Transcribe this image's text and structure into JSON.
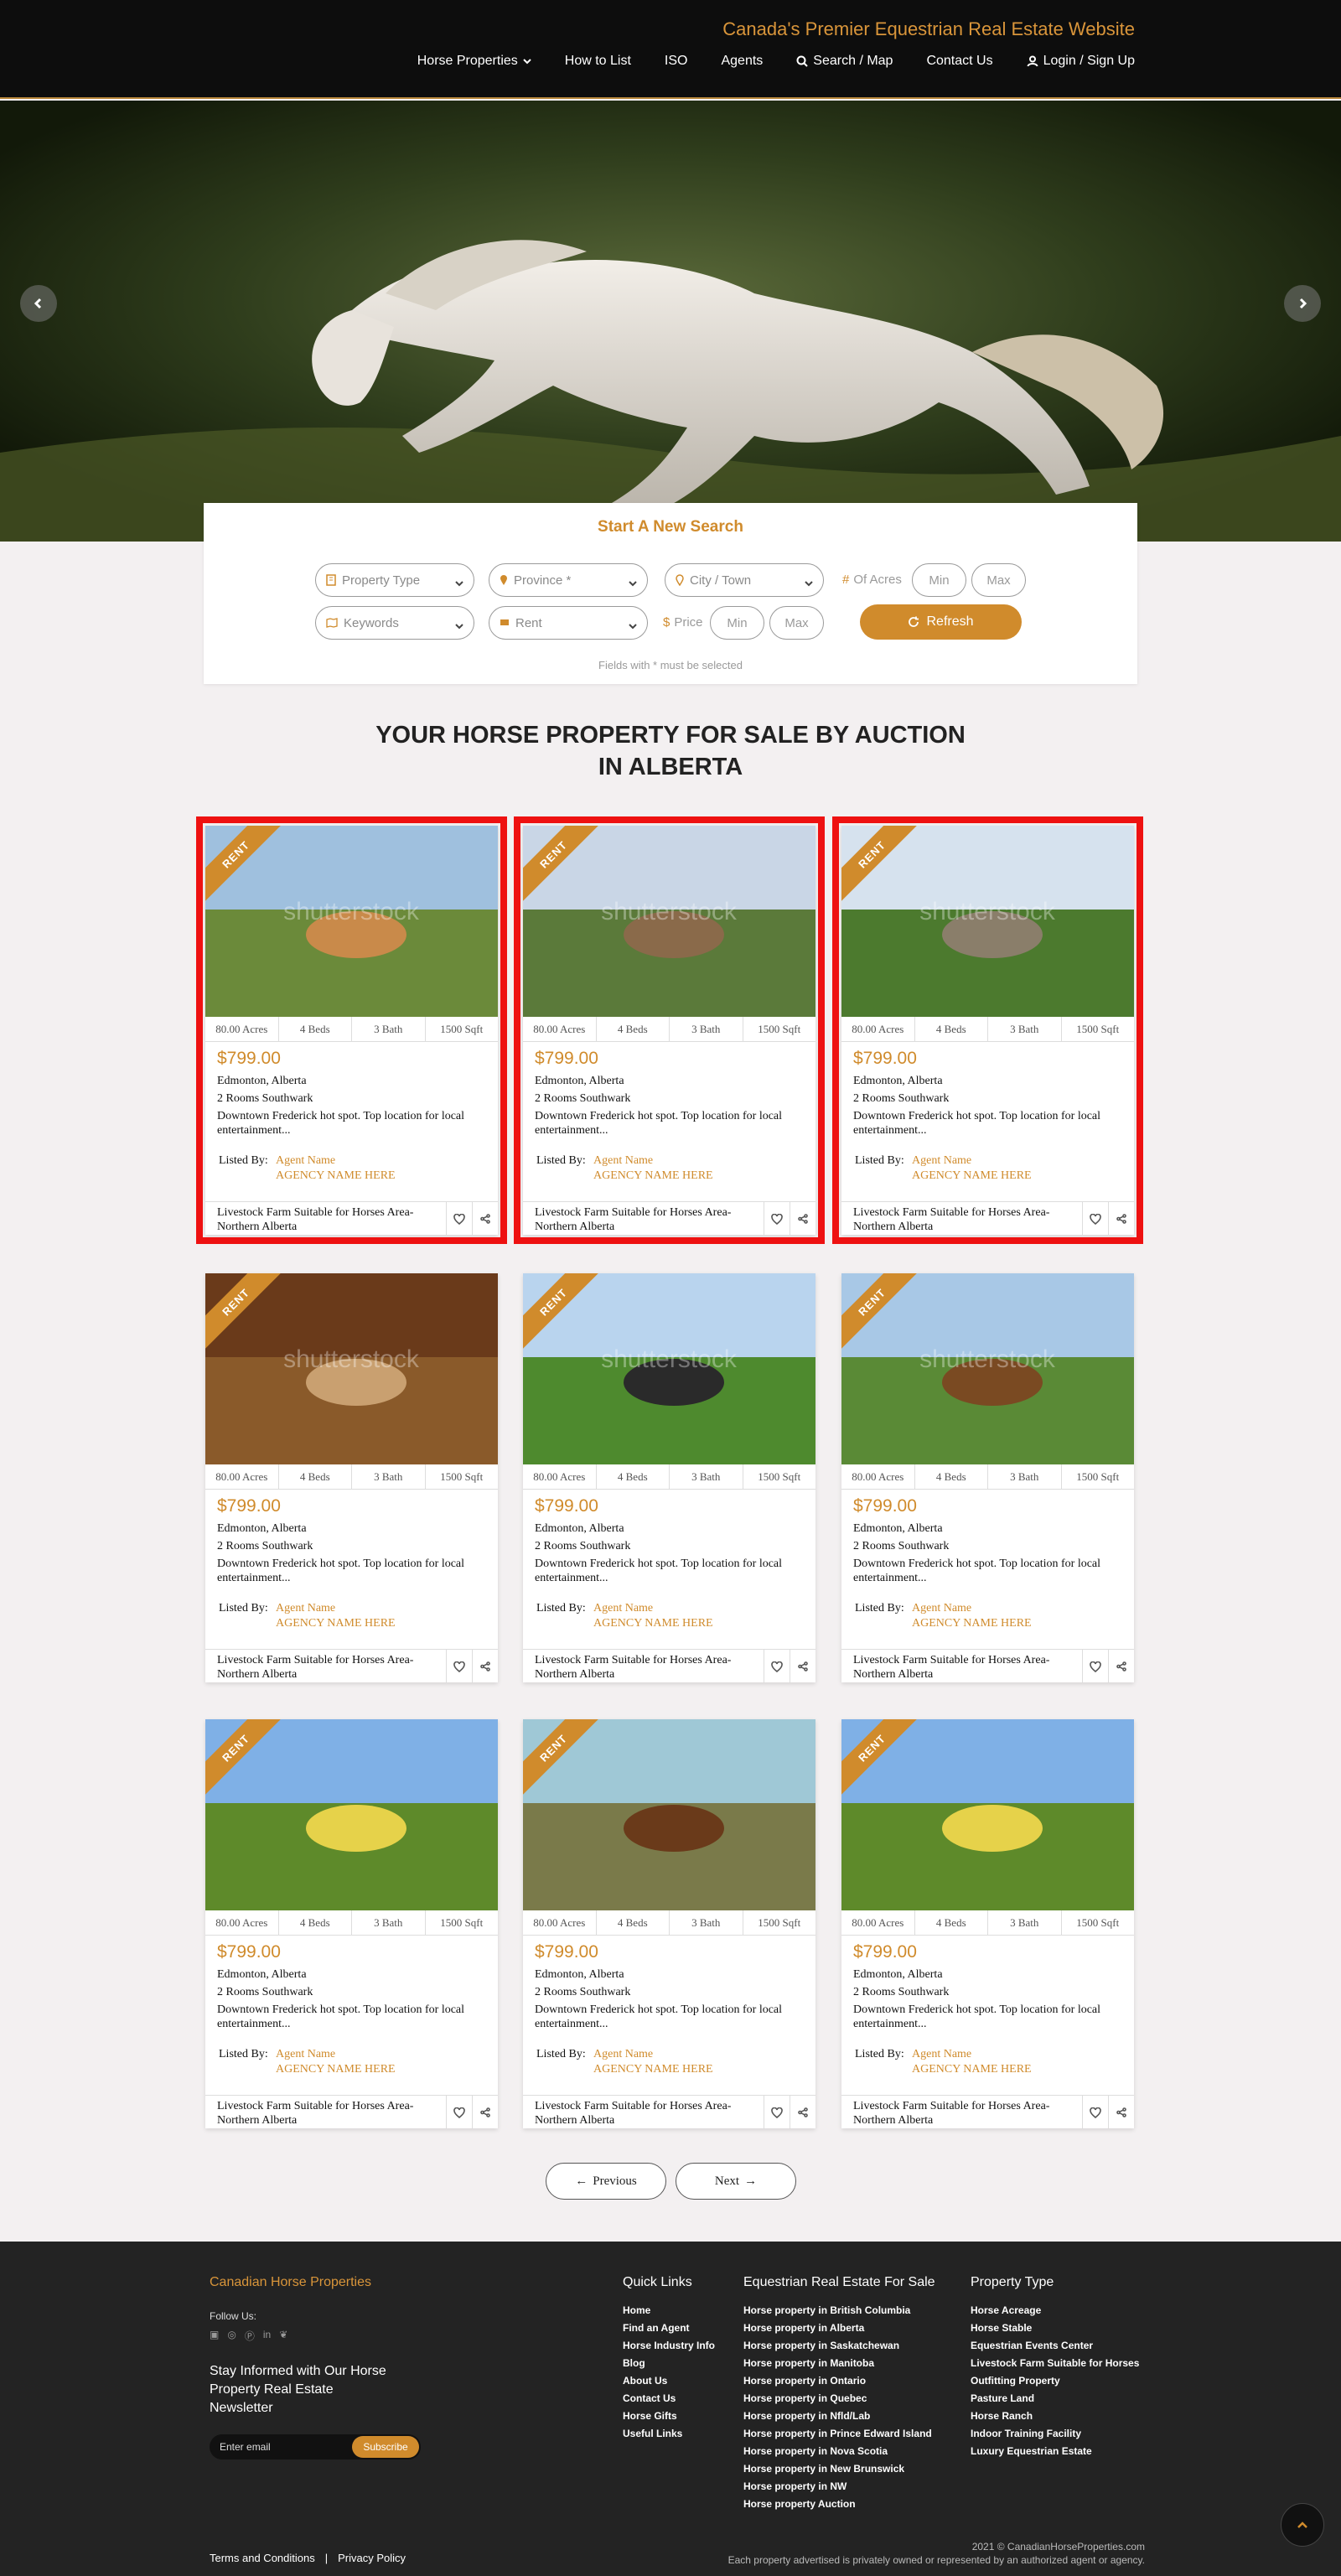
{
  "header": {
    "tagline": "Canada's Premier Equestrian Real Estate Website",
    "nav": [
      "Horse Properties",
      "How to List",
      "ISO",
      "Agents",
      "Search / Map",
      "Contact Us",
      "Login / Sign Up"
    ]
  },
  "search": {
    "title": "Start A New Search",
    "property_type": "Property Type",
    "province": "Province *",
    "city": "City / Town",
    "of_acres": "Of Acres",
    "keywords": "Keywords",
    "rent": "Rent",
    "price_label": "Price",
    "min": "Min",
    "max": "Max",
    "refresh": "Refresh",
    "note": "Fields with * must be selected"
  },
  "section_title_line1": "YOUR HORSE PROPERTY FOR SALE BY AUCTION",
  "section_title_line2": "IN ALBERTA",
  "listings": [
    {
      "badge": "RENT",
      "acres": "80.00 Acres",
      "beds": "4 Beds",
      "bath": "3 Bath",
      "sqft": "1500 Sqft",
      "price": "$799.00",
      "location": "Edmonton, Alberta",
      "rooms": "2 Rooms Southwark",
      "desc": "Downtown Frederick hot spot. Top location for local entertainment...",
      "listed_by": "Listed By:",
      "agent": "Agent Name",
      "agency": "AGENCY NAME HERE",
      "title": "Livestock Farm Suitable for Horses Area-Northern Alberta"
    },
    {
      "badge": "RENT",
      "acres": "80.00 Acres",
      "beds": "4 Beds",
      "bath": "3 Bath",
      "sqft": "1500 Sqft",
      "price": "$799.00",
      "location": "Edmonton, Alberta",
      "rooms": "2 Rooms Southwark",
      "desc": "Downtown Frederick hot spot. Top location for local entertainment...",
      "listed_by": "Listed By:",
      "agent": "Agent Name",
      "agency": "AGENCY NAME HERE",
      "title": "Livestock Farm Suitable for Horses Area-Northern Alberta"
    },
    {
      "badge": "RENT",
      "acres": "80.00 Acres",
      "beds": "4 Beds",
      "bath": "3 Bath",
      "sqft": "1500 Sqft",
      "price": "$799.00",
      "location": "Edmonton, Alberta",
      "rooms": "2 Rooms Southwark",
      "desc": "Downtown Frederick hot spot. Top location for local entertainment...",
      "listed_by": "Listed By:",
      "agent": "Agent Name",
      "agency": "AGENCY NAME HERE",
      "title": "Livestock Farm Suitable for Horses Area-Northern Alberta"
    },
    {
      "badge": "RENT",
      "acres": "80.00 Acres",
      "beds": "4 Beds",
      "bath": "3 Bath",
      "sqft": "1500 Sqft",
      "price": "$799.00",
      "location": "Edmonton, Alberta",
      "rooms": "2 Rooms Southwark",
      "desc": "Downtown Frederick hot spot. Top location for local entertainment...",
      "listed_by": "Listed By:",
      "agent": "Agent Name",
      "agency": "AGENCY NAME HERE",
      "title": "Livestock Farm Suitable for Horses Area-Northern Alberta"
    },
    {
      "badge": "RENT",
      "acres": "80.00 Acres",
      "beds": "4 Beds",
      "bath": "3 Bath",
      "sqft": "1500 Sqft",
      "price": "$799.00",
      "location": "Edmonton, Alberta",
      "rooms": "2 Rooms Southwark",
      "desc": "Downtown Frederick hot spot. Top location for local entertainment...",
      "listed_by": "Listed By:",
      "agent": "Agent Name",
      "agency": "AGENCY NAME HERE",
      "title": "Livestock Farm Suitable for Horses Area-Northern Alberta"
    },
    {
      "badge": "RENT",
      "acres": "80.00 Acres",
      "beds": "4 Beds",
      "bath": "3 Bath",
      "sqft": "1500 Sqft",
      "price": "$799.00",
      "location": "Edmonton, Alberta",
      "rooms": "2 Rooms Southwark",
      "desc": "Downtown Frederick hot spot. Top location for local entertainment...",
      "listed_by": "Listed By:",
      "agent": "Agent Name",
      "agency": "AGENCY NAME HERE",
      "title": "Livestock Farm Suitable for Horses Area-Northern Alberta"
    },
    {
      "badge": "RENT",
      "acres": "80.00 Acres",
      "beds": "4 Beds",
      "bath": "3 Bath",
      "sqft": "1500 Sqft",
      "price": "$799.00",
      "location": "Edmonton, Alberta",
      "rooms": "2 Rooms Southwark",
      "desc": "Downtown Frederick hot spot. Top location for local entertainment...",
      "listed_by": "Listed By:",
      "agent": "Agent Name",
      "agency": "AGENCY NAME HERE",
      "title": "Livestock Farm Suitable for Horses Area-Northern Alberta"
    },
    {
      "badge": "RENT",
      "acres": "80.00 Acres",
      "beds": "4 Beds",
      "bath": "3 Bath",
      "sqft": "1500 Sqft",
      "price": "$799.00",
      "location": "Edmonton, Alberta",
      "rooms": "2 Rooms Southwark",
      "desc": "Downtown Frederick hot spot. Top location for local entertainment...",
      "listed_by": "Listed By:",
      "agent": "Agent Name",
      "agency": "AGENCY NAME HERE",
      "title": "Livestock Farm Suitable for Horses Area-Northern Alberta"
    },
    {
      "badge": "RENT",
      "acres": "80.00 Acres",
      "beds": "4 Beds",
      "bath": "3 Bath",
      "sqft": "1500 Sqft",
      "price": "$799.00",
      "location": "Edmonton, Alberta",
      "rooms": "2 Rooms Southwark",
      "desc": "Downtown Frederick hot spot. Top location for local entertainment...",
      "listed_by": "Listed By:",
      "agent": "Agent Name",
      "agency": "AGENCY NAME HERE",
      "title": "Livestock Farm Suitable for Horses Area-Northern Alberta"
    }
  ],
  "watermark": "shutterstock",
  "pagination": {
    "previous": "Previous",
    "next": "Next"
  },
  "footer": {
    "brand": "Canadian Horse Properties",
    "follow": "Follow Us:",
    "stay": "Stay Informed with Our Horse Property Real Estate Newsletter",
    "email_placeholder": "Enter email",
    "subscribe": "Subscribe",
    "quick_links_title": "Quick Links",
    "quick_links": [
      "Home",
      "Find an Agent",
      "Horse Industry Info",
      "Blog",
      "About Us",
      "Contact Us",
      "Horse Gifts",
      "Useful Links"
    ],
    "equestrian_title": "Equestrian Real Estate For Sale",
    "equestrian_links": [
      "Horse property in British Columbia",
      "Horse property in Alberta",
      "Horse property in Saskatchewan",
      "Horse property in Manitoba",
      "Horse property in Ontario",
      "Horse property in Quebec",
      "Horse property in Nfld/Lab",
      "Horse property in Prince Edward Island",
      "Horse property in Nova Scotia",
      "Horse property in New Brunswick",
      "Horse property in NW",
      "Horse property Auction"
    ],
    "property_type_title": "Property Type",
    "property_types": [
      "Horse Acreage",
      "Horse Stable",
      "Equestrian Events Center",
      "Livestock Farm Suitable for Horses",
      "Outfitting Property",
      "Pasture Land",
      "Horse Ranch",
      "Indoor Training Facility",
      "Luxury Equestrian Estate"
    ],
    "terms": "Terms and Conditions",
    "separator": "|",
    "privacy": "Privacy Policy",
    "copyright": "2021 © CanadianHorseProperties.com",
    "disclaimer": "Each property advertised is privately owned or represented by an authorized agent or agency."
  },
  "colors": {
    "accent": "#d08b2c",
    "header_bg": "#0d0d0d",
    "footer_bg": "#232323",
    "highlight": "#ee1111"
  }
}
